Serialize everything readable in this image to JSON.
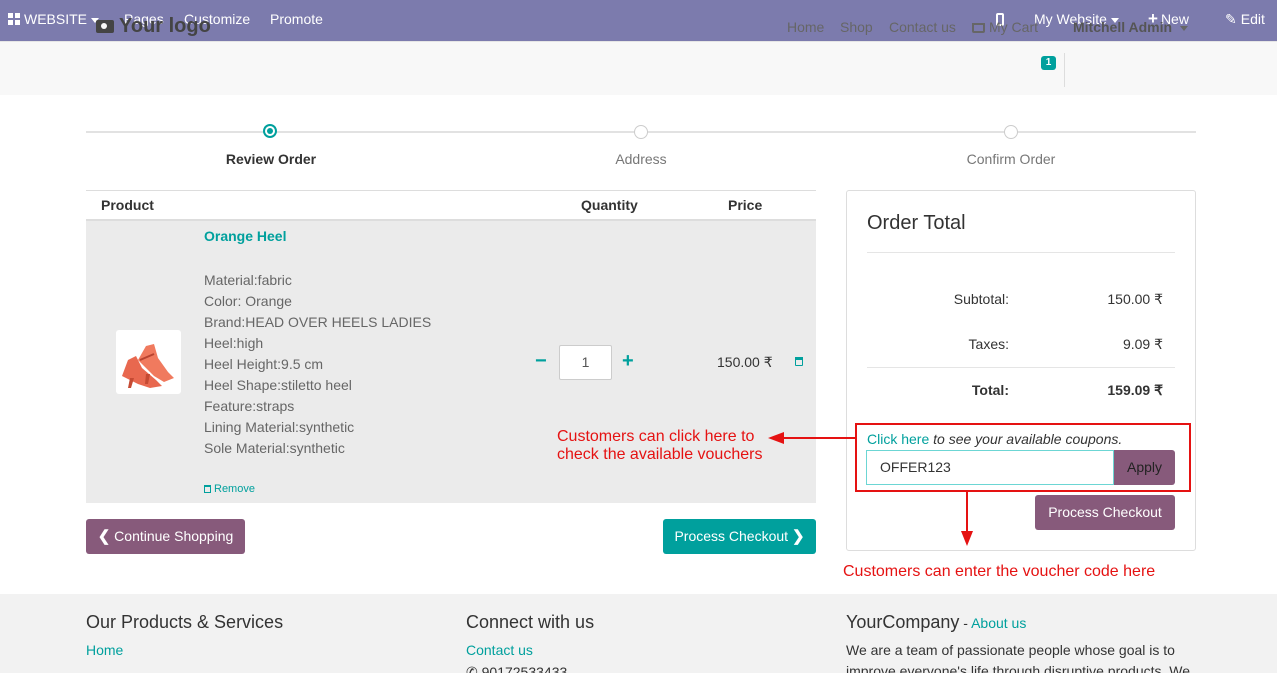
{
  "topbar": {
    "website_menu": "WEBSITE",
    "pages": "Pages",
    "customize": "Customize",
    "promote": "Promote",
    "my_website": "My Website",
    "new": "New",
    "edit": "Edit"
  },
  "header": {
    "logo_text": "Your logo",
    "nav": {
      "home": "Home",
      "shop": "Shop",
      "contact": "Contact us",
      "cart": "My Cart",
      "cart_count": "1",
      "user": "Mitchell Admin"
    }
  },
  "wizard": {
    "steps": [
      "Review Order",
      "Address",
      "Confirm Order"
    ],
    "active_step": "Review Order"
  },
  "cart_table": {
    "headers": {
      "product": "Product",
      "quantity": "Quantity",
      "price": "Price"
    },
    "item": {
      "name": "Orange Heel",
      "attributes": [
        "Material:fabric",
        "Color: Orange",
        "Brand:HEAD OVER HEELS LADIES",
        "Heel:high",
        "Heel Height:9.5 cm",
        "Heel Shape:stiletto heel",
        "Feature:straps",
        "Lining Material:synthetic",
        "Sole Material:synthetic"
      ],
      "remove_label": "Remove",
      "quantity": "1",
      "minus": "−",
      "plus": "+",
      "price": "150.00 ₹"
    }
  },
  "buttons": {
    "continue_shopping": "Continue Shopping",
    "process_checkout": "Process Checkout",
    "process_checkout_panel": "Process Checkout",
    "apply": "Apply"
  },
  "order_total": {
    "title": "Order Total",
    "subtotal_label": "Subtotal:",
    "subtotal": "150.00 ₹",
    "taxes_label": "Taxes:",
    "taxes": "9.09 ₹",
    "total_label": "Total:",
    "total": "159.09 ₹"
  },
  "coupon": {
    "link_text": "Click here",
    "hint_text": " to see your available coupons.",
    "code": "OFFER123"
  },
  "annotations": {
    "click_here_line1": "Customers can click here to",
    "click_here_line2": "check the available vouchers",
    "enter_code": "Customers can enter the voucher code here"
  },
  "footer": {
    "products_title": "Our Products & Services",
    "products_home": "Home",
    "connect_title": "Connect with us",
    "connect_contact": "Contact us",
    "connect_phone": "90172533433",
    "company_title": "YourCompany",
    "company_sep": " - ",
    "about_link": "About us",
    "company_text": "We are a team of passionate people whose goal is to improve everyone's life through disruptive products. We"
  },
  "colors": {
    "topbar": "#7c7bad",
    "accent": "#00a09d",
    "purple_button": "#875a7b",
    "annotation": "#e51212"
  }
}
